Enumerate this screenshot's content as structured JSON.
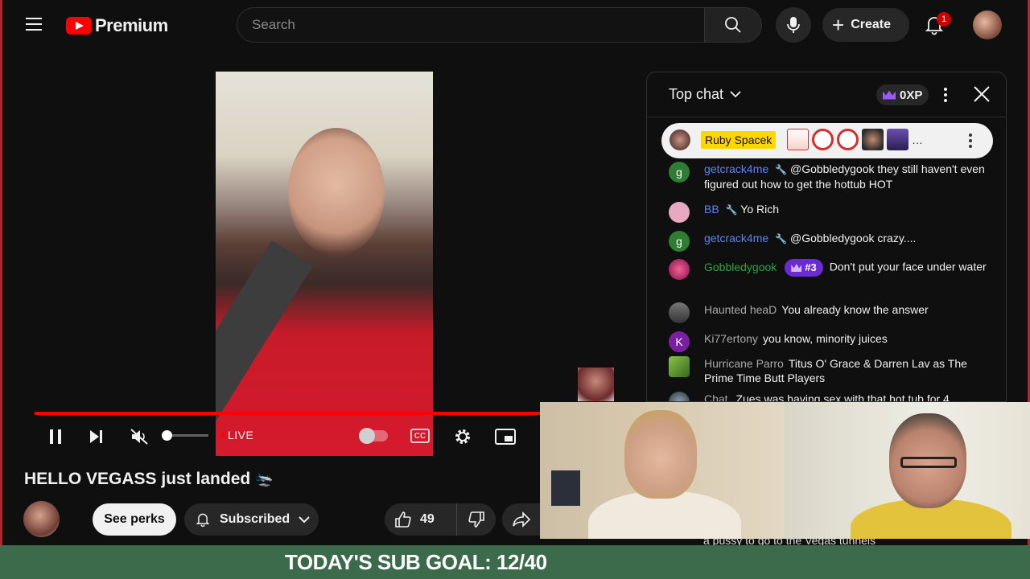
{
  "header": {
    "logo_text": "Premium",
    "search_placeholder": "Search",
    "create_label": "Create",
    "notification_count": "1"
  },
  "player": {
    "live_label": "LIVE",
    "progress_fraction": 0.86,
    "volume_fraction": 0.0,
    "cc_label": "CC"
  },
  "video": {
    "title": "HELLO VEGASS just landed",
    "title_emoji": "🛬",
    "perks_label": "See perks",
    "subscribed_label": "Subscribed",
    "like_count": "49"
  },
  "chat": {
    "title": "Top chat",
    "xp_label": "0XP",
    "pinned": {
      "author": "Ruby Spacek",
      "ellipsis": "…"
    },
    "messages": [
      {
        "author": "getcrack4me",
        "mod": true,
        "avatar": "g",
        "avatar_color": "#2e7d32",
        "text": "@Gobbledygook they still haven't even figured out how to get the hottub HOT"
      },
      {
        "author": "BB",
        "mod": true,
        "avatar": "",
        "avatar_color": "#e8a8c0",
        "text": "Yo Rich"
      },
      {
        "author": "getcrack4me",
        "mod": true,
        "avatar": "g",
        "avatar_color": "#2e7d32",
        "text": "@Gobbledygook crazy...."
      },
      {
        "author": "Gobbledygook",
        "member": true,
        "rank": "#3",
        "avatar": "",
        "avatar_color": "#c2185b",
        "text": "Don't put your face under water"
      },
      {
        "author": "Haunted heaD",
        "avatar": "",
        "avatar_color": "#555555",
        "text": "You already know the answer"
      },
      {
        "author": "Ki77ertony",
        "avatar": "K",
        "avatar_color": "#7b1fa2",
        "text": "you know, minority juices"
      },
      {
        "author": "Hurricane Parro",
        "avatar": "",
        "avatar_color": "#33691e",
        "text": "Titus O' Grace & Darren Lav as The Prime Time Butt Players"
      },
      {
        "author": "Chat.",
        "avatar": "",
        "avatar_color": "#37474f",
        "text": "Zues was having sex with that hot tub for 4"
      }
    ],
    "bottom_line": "a pussy to go to the Vegas tunnels"
  },
  "overlay": {
    "sub_goal": "TODAY'S SUB GOAL: 12/40"
  },
  "colors": {
    "accent": "#ff0000",
    "mod_name": "#5e84f1",
    "member_name": "#2ba640",
    "pinned_name_bg": "#ffd600",
    "goal_banner": "#3b6b4a"
  }
}
